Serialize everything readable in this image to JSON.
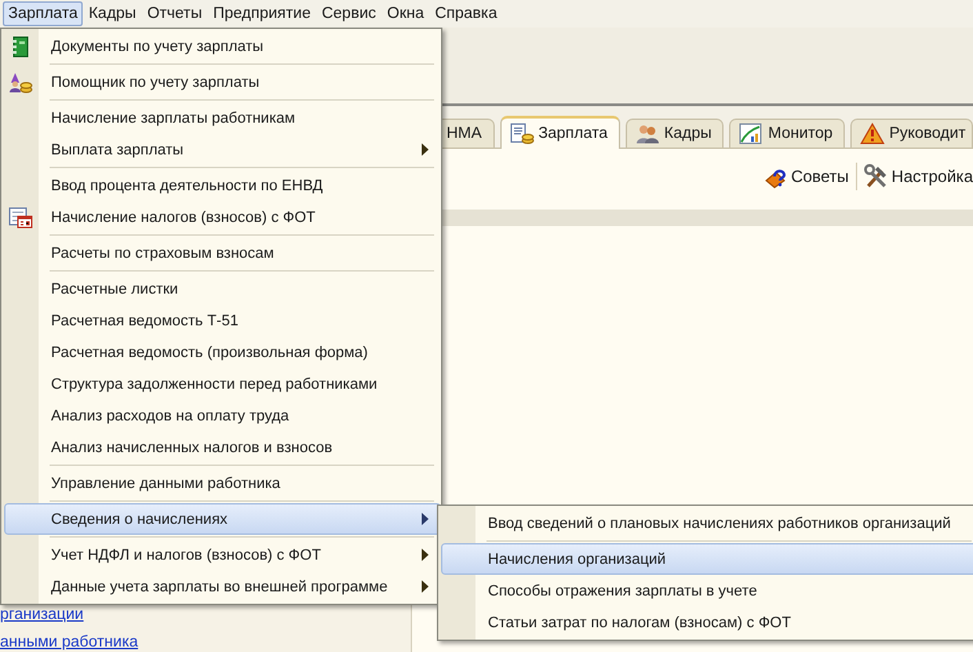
{
  "menubar": [
    {
      "label": "Зарплата",
      "selected": true
    },
    {
      "label": "Кадры",
      "selected": false
    },
    {
      "label": "Отчеты",
      "selected": false
    },
    {
      "label": "Предприятие",
      "selected": false
    },
    {
      "label": "Сервис",
      "selected": false
    },
    {
      "label": "Окна",
      "selected": false
    },
    {
      "label": "Справка",
      "selected": false
    }
  ],
  "tabs": [
    {
      "label": "НМА",
      "selected": false
    },
    {
      "label": "Зарплата",
      "selected": true
    },
    {
      "label": "Кадры",
      "selected": false
    },
    {
      "label": "Монитор",
      "selected": false
    },
    {
      "label": "Руководит",
      "selected": false
    }
  ],
  "toolbar": [
    "Советы",
    "Настройка"
  ],
  "left_links": [
    "рганизации",
    "анными работника"
  ],
  "menu": [
    {
      "kind": "item",
      "label": "Документы по учету зарплаты",
      "has_submenu": false,
      "selected": false
    },
    {
      "kind": "separator"
    },
    {
      "kind": "item",
      "label": "Помощник по учету зарплаты",
      "has_submenu": false,
      "selected": false
    },
    {
      "kind": "separator"
    },
    {
      "kind": "item",
      "label": "Начисление зарплаты работникам",
      "has_submenu": false,
      "selected": false
    },
    {
      "kind": "item",
      "label": "Выплата зарплаты",
      "has_submenu": true,
      "selected": false
    },
    {
      "kind": "separator"
    },
    {
      "kind": "item",
      "label": "Ввод процента деятельности по ЕНВД",
      "has_submenu": false,
      "selected": false
    },
    {
      "kind": "item",
      "label": "Начисление налогов (взносов) с ФОТ",
      "has_submenu": false,
      "selected": false
    },
    {
      "kind": "separator"
    },
    {
      "kind": "item",
      "label": "Расчеты по страховым взносам",
      "has_submenu": false,
      "selected": false
    },
    {
      "kind": "separator"
    },
    {
      "kind": "item",
      "label": "Расчетные листки",
      "has_submenu": false,
      "selected": false
    },
    {
      "kind": "item",
      "label": "Расчетная ведомость Т-51",
      "has_submenu": false,
      "selected": false
    },
    {
      "kind": "item",
      "label": "Расчетная ведомость (произвольная форма)",
      "has_submenu": false,
      "selected": false
    },
    {
      "kind": "item",
      "label": "Структура задолженности перед работниками",
      "has_submenu": false,
      "selected": false
    },
    {
      "kind": "item",
      "label": "Анализ расходов на оплату труда",
      "has_submenu": false,
      "selected": false
    },
    {
      "kind": "item",
      "label": "Анализ начисленных налогов и взносов",
      "has_submenu": false,
      "selected": false
    },
    {
      "kind": "separator"
    },
    {
      "kind": "item",
      "label": "Управление данными работника",
      "has_submenu": false,
      "selected": false
    },
    {
      "kind": "separator"
    },
    {
      "kind": "item",
      "label": "Сведения о начислениях",
      "has_submenu": true,
      "selected": true
    },
    {
      "kind": "separator"
    },
    {
      "kind": "item",
      "label": "Учет НДФЛ и налогов (взносов) с ФОТ",
      "has_submenu": true,
      "selected": false
    },
    {
      "kind": "item",
      "label": "Данные учета зарплаты во внешней программе",
      "has_submenu": true,
      "selected": false
    }
  ],
  "submenu": [
    {
      "kind": "item",
      "label": "Ввод сведений о плановых начислениях работников организаций",
      "selected": false
    },
    {
      "kind": "separator"
    },
    {
      "kind": "item",
      "label": "Начисления организаций",
      "selected": true
    },
    {
      "kind": "item",
      "label": "Способы отражения зарплаты в учете",
      "selected": false
    },
    {
      "kind": "item",
      "label": "Статьи затрат по налогам (взносам) с ФОТ",
      "selected": false
    }
  ]
}
